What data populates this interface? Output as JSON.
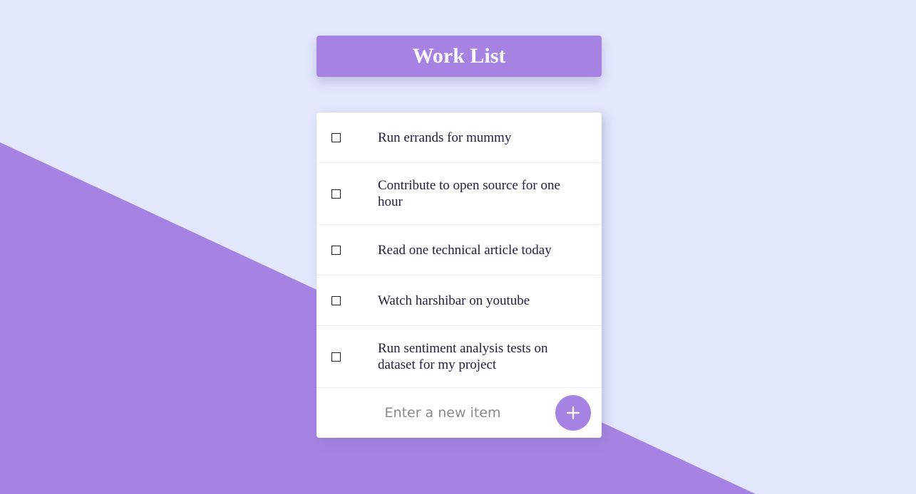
{
  "app": {
    "title": "Work List"
  },
  "items": [
    {
      "text": "Run errands for mummy",
      "checked": false
    },
    {
      "text": "Contribute to open source for one hour",
      "checked": false
    },
    {
      "text": "Read one technical article today",
      "checked": false
    },
    {
      "text": "Watch harshibar on youtube",
      "checked": false
    },
    {
      "text": "Run sentiment analysis tests on dataset for my project",
      "checked": false
    }
  ],
  "new_item": {
    "placeholder": "Enter a new item",
    "value": ""
  },
  "add_button": {
    "icon": "plus-icon"
  },
  "colors": {
    "background": "#e2e7fc",
    "accent": "#a683e3",
    "card": "#ffffff",
    "text": "#1c2040"
  }
}
